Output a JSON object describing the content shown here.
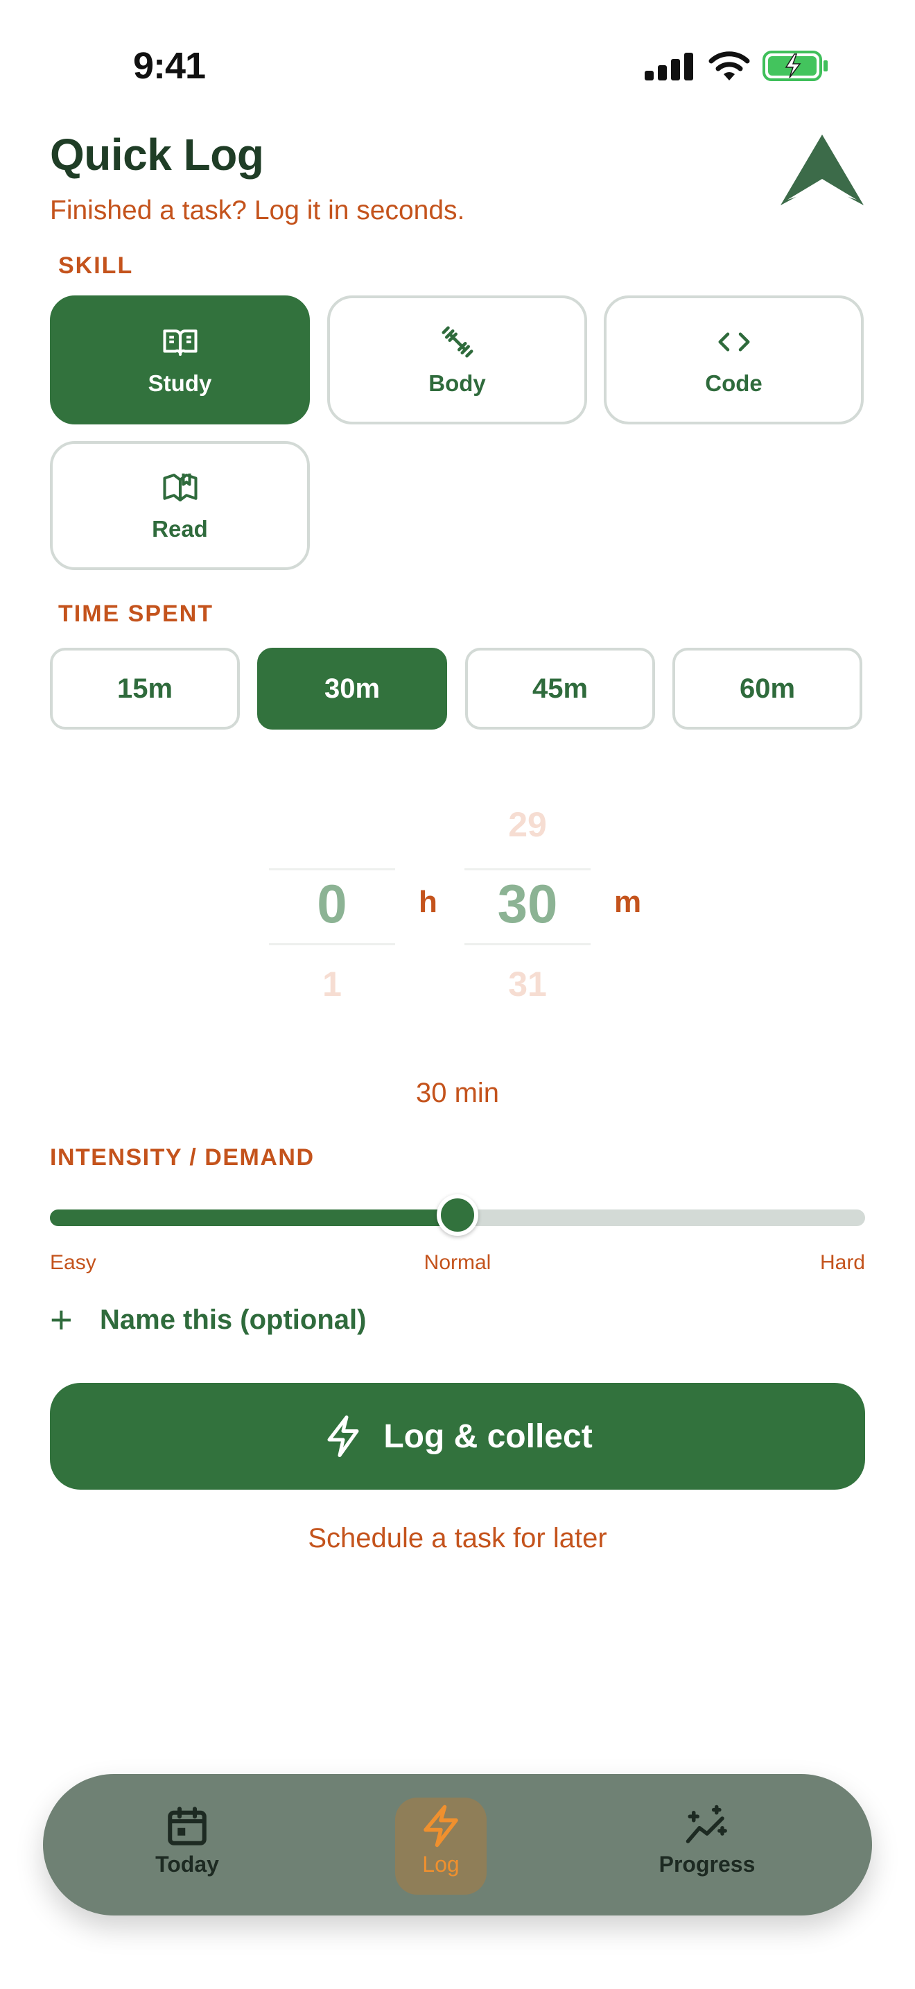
{
  "status_bar": {
    "time": "9:41",
    "icons": [
      "cellular-signal-icon",
      "wifi-icon",
      "battery-charging-icon"
    ]
  },
  "header": {
    "title": "Quick Log",
    "subtitle": "Finished a task? Log it in seconds.",
    "logo": "arrow-mountain-logo"
  },
  "skill": {
    "label": "SKILL",
    "items": [
      {
        "label": "Study",
        "icon": "open-book-icon",
        "selected": true
      },
      {
        "label": "Body",
        "icon": "dumbbell-icon",
        "selected": false
      },
      {
        "label": "Code",
        "icon": "code-brackets-icon",
        "selected": false
      },
      {
        "label": "Read",
        "icon": "reading-book-icon",
        "selected": false
      }
    ]
  },
  "time_spent": {
    "label": "TIME SPENT",
    "options": [
      {
        "label": "15m",
        "selected": false
      },
      {
        "label": "30m",
        "selected": true
      },
      {
        "label": "45m",
        "selected": false
      },
      {
        "label": "60m",
        "selected": false
      }
    ]
  },
  "picker": {
    "hours": {
      "selected": "0",
      "next": "1",
      "unit": "h"
    },
    "minutes": {
      "prev": "29",
      "selected": "30",
      "next": "31",
      "unit": "m"
    },
    "total": "30 min"
  },
  "intensity": {
    "label": "INTENSITY / DEMAND",
    "value": 0.5,
    "min_label": "Easy",
    "mid_label": "Normal",
    "max_label": "Hard"
  },
  "name_optional": {
    "label": "Name this (optional)",
    "icon": "plus-icon"
  },
  "cta": {
    "label": "Log & collect",
    "icon": "lightning-icon"
  },
  "schedule_link": "Schedule a task for later",
  "tab_bar": {
    "tabs": [
      {
        "label": "Today",
        "icon": "calendar-icon",
        "active": false
      },
      {
        "label": "Log",
        "icon": "lightning-icon",
        "active": true
      },
      {
        "label": "Progress",
        "icon": "sparkle-chart-icon",
        "active": false
      }
    ],
    "active_color": "#f0902e"
  },
  "colors": {
    "primary": "#32723d",
    "accent": "#c4531c",
    "border": "#d3dad6"
  }
}
